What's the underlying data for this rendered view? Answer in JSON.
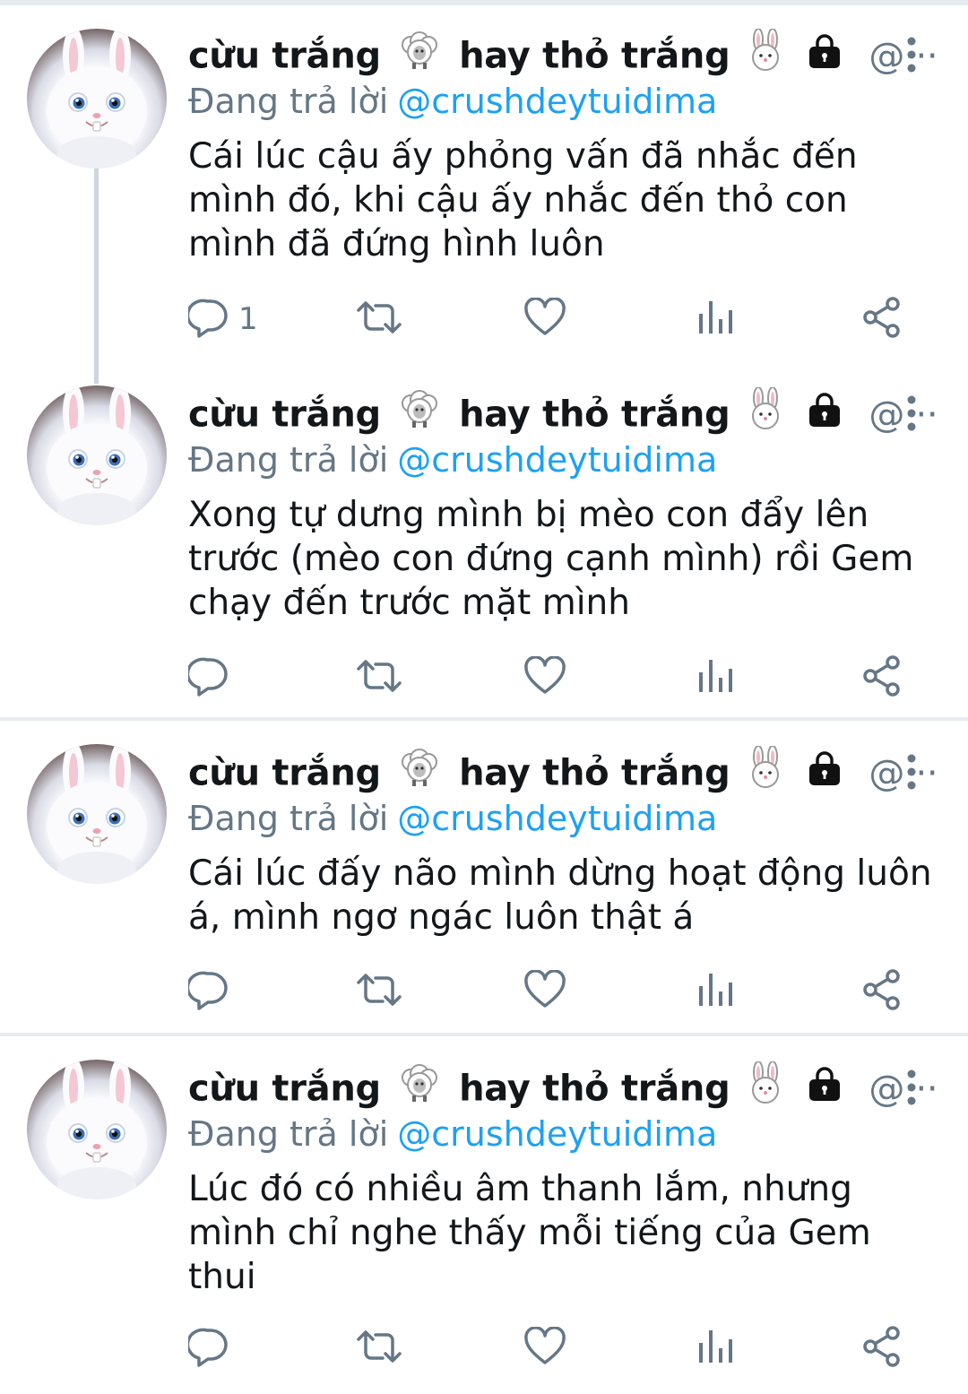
{
  "tweets": [
    {
      "display_name": "cừu trắng",
      "name_mid": "hay thỏ trắng",
      "handle": "@···",
      "replying_label": "Đang trả lời",
      "replying_to": "@crushdeytuidima",
      "text": "Cái lúc cậu ấy phỏng vấn đã nhắc đến mình đó, khi cậu ấy nhắc đến thỏ con mình đã đứng hình luôn",
      "reply_count": "1"
    },
    {
      "display_name": "cừu trắng",
      "name_mid": "hay thỏ trắng",
      "handle": "@···",
      "replying_label": "Đang trả lời",
      "replying_to": "@crushdeytuidima",
      "text": "Xong tự dưng mình bị mèo con đẩy lên trước (mèo con đứng cạnh mình) rồi Gem chạy đến trước mặt mình",
      "reply_count": ""
    },
    {
      "display_name": "cừu trắng",
      "name_mid": "hay thỏ trắng",
      "handle": "@···",
      "replying_label": "Đang trả lời",
      "replying_to": "@crushdeytuidima",
      "text": "Cái lúc đấy não mình dừng hoạt động luôn á, mình ngơ ngác luôn thật á",
      "reply_count": ""
    },
    {
      "display_name": "cừu trắng",
      "name_mid": "hay thỏ trắng",
      "handle": "@···",
      "replying_label": "Đang trả lời",
      "replying_to": "@crushdeytuidima",
      "text": "Lúc đó có nhiều âm thanh lắm, nhưng mình chỉ nghe thấy mỗi tiếng của Gem thui",
      "reply_count": ""
    }
  ],
  "icons": [
    "sheep-icon",
    "rabbit-icon",
    "lock-icon",
    "more-vertical-icon",
    "reply-icon",
    "retweet-icon",
    "like-icon",
    "analytics-icon",
    "share-icon"
  ],
  "colors": {
    "link": "#1da1f2",
    "secondary": "#657786",
    "text": "#14171a",
    "separator": "#e6ecf0"
  }
}
